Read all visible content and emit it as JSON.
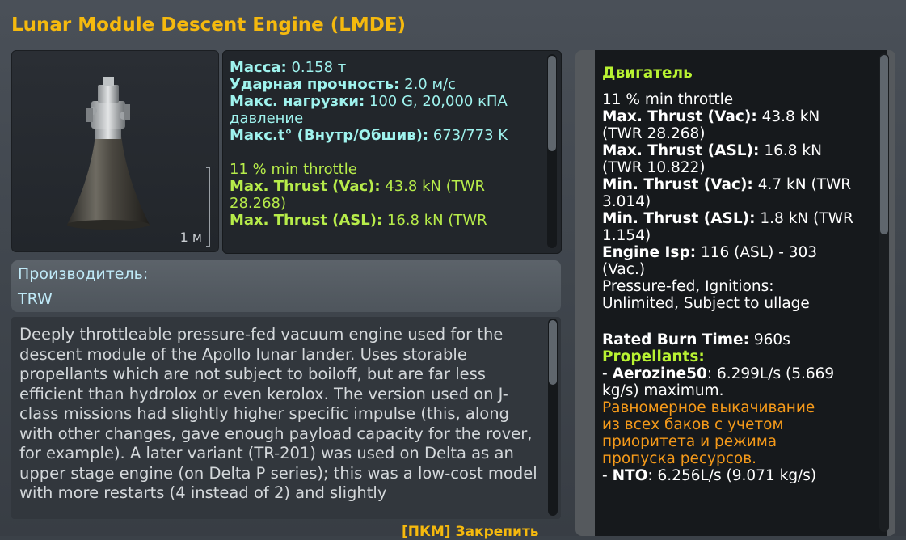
{
  "title": "Lunar Module Descent Engine (LMDE)",
  "thumbnail": {
    "scale_label": "1 м"
  },
  "stats": {
    "mass_label": "Масса:",
    "mass_value": "0.158 т",
    "impact_label": "Ударная прочность:",
    "impact_value": "2.0 м/с",
    "max_load_label": "Макс. нагрузки:",
    "max_load_value": "100 G, 20,000 кПА",
    "max_load_value2": "давление",
    "temp_label": "Макс.t° (Внутр/Обшив):",
    "temp_value": "673/773 K",
    "min_throttle": "11 % min throttle",
    "thrust_vac_label": "Max. Thrust (Vac):",
    "thrust_vac_value": "43.8 kN (TWR",
    "thrust_vac_value2": "28.268)",
    "thrust_asl_label": "Max. Thrust (ASL):",
    "thrust_asl_value": "16.8 kN (TWR"
  },
  "manufacturer": {
    "label": "Производитель:",
    "value": "TRW"
  },
  "description": "Deeply throttleable pressure-fed vacuum engine used for the descent module of the Apollo lunar lander. Uses storable propellants which are not subject to boiloff, but are far less efficient than hydrolox or even kerolox. The version used on J-class missions had slightly higher specific impulse (this, along with other changes, gave enough payload capacity for the rover, for example). A later variant (TR-201) was used on Delta as an upper stage engine (on Delta P series); this was a low-cost model with more restarts (4 instead of 2) and slightly",
  "bottom_hint": "[ПКМ] Закрепить",
  "bottom_left": "~~~~~~~~~~~~",
  "engine_panel": {
    "header": "Двигатель",
    "min_throttle": "11 % min throttle",
    "max_thrust_vac_label": "Max. Thrust (Vac):",
    "max_thrust_vac_value": "43.8 kN",
    "max_thrust_vac_twr": "(TWR 28.268)",
    "max_thrust_asl_label": "Max. Thrust (ASL):",
    "max_thrust_asl_value": "16.8 kN",
    "max_thrust_asl_twr": "(TWR 10.822)",
    "min_thrust_vac_label": "Min. Thrust (Vac):",
    "min_thrust_vac_value": "4.7 kN (TWR",
    "min_thrust_vac_twr": "3.014)",
    "min_thrust_asl_label": "Min. Thrust (ASL):",
    "min_thrust_asl_value": "1.8 kN (TWR",
    "min_thrust_asl_twr": "1.154)",
    "isp_label": "Engine Isp:",
    "isp_value": "116 (ASL) - 303",
    "isp_value2": "(Vac.)",
    "feed_line1": "Pressure-fed, Ignitions:",
    "feed_line2": "Unlimited, Subject to ullage",
    "burn_label": "Rated Burn Time:",
    "burn_value": "960s",
    "propellants_label": "Propellants:",
    "prop1_dash": "- ",
    "prop1_name": "Aerozine50",
    "prop1_rate": ": 6.299L/s (5.669",
    "prop1_rate2": "kg/s) maximum.",
    "flow_note1": "Равномерное выкачивание",
    "flow_note2": "из всех баков с учетом",
    "flow_note3": "приоритета и режима",
    "flow_note4": "пропуска ресурсов.",
    "prop2_dash": "- ",
    "prop2_name": "NTO",
    "prop2_rate": ": 6.256L/s (9.071 kg/s)"
  },
  "colors": {
    "title": "#f5b90e",
    "stat_text": "#9ff3ee",
    "engine_stat": "#b7ec4a",
    "panel_header": "#b8f232",
    "warning": "#f59a1a"
  }
}
